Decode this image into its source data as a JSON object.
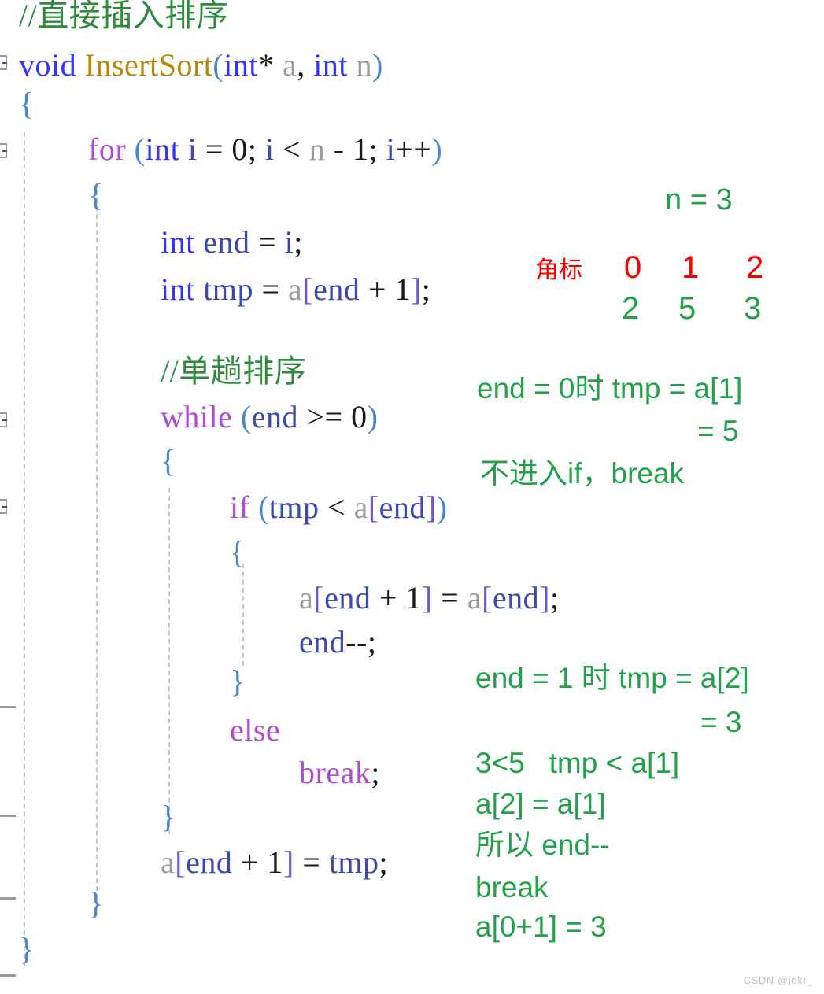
{
  "editor": {
    "language": "cpp",
    "colors": {
      "comment": "#2e8b3d",
      "keyword": "#b14ad6",
      "type": "#3333ff",
      "function": "#b8860b",
      "variable": "#3b49b0",
      "identifier": "#9b9b9b",
      "brace": "#4a86c8",
      "annotation_green": "#22a24b",
      "annotation_red": "#ff0000",
      "guide": "#c7c7c7",
      "background": "#ffffff"
    },
    "code_lines": [
      {
        "id": "comment-header",
        "indent": 1,
        "tokens": [
          {
            "cls": "t-com",
            "text": "//直接插入排序"
          }
        ]
      },
      {
        "id": "fn-signature",
        "indent": 0,
        "tokens": [
          {
            "cls": "t-type",
            "text": "void"
          },
          {
            "cls": "t-pun",
            "text": " "
          },
          {
            "cls": "t-fn",
            "text": "InsertSort"
          },
          {
            "cls": "t-brace",
            "text": "("
          },
          {
            "cls": "t-type",
            "text": "int"
          },
          {
            "cls": "t-pun",
            "text": "* "
          },
          {
            "cls": "t-gray",
            "text": "a"
          },
          {
            "cls": "t-pun",
            "text": ", "
          },
          {
            "cls": "t-type",
            "text": "int"
          },
          {
            "cls": "t-pun",
            "text": " "
          },
          {
            "cls": "t-gray",
            "text": "n"
          },
          {
            "cls": "t-brace",
            "text": ")"
          }
        ]
      },
      {
        "id": "fn-open-brace",
        "indent": 0,
        "tokens": [
          {
            "cls": "t-brace",
            "text": "{"
          }
        ]
      },
      {
        "id": "for-loop",
        "indent": 1,
        "tokens": [
          {
            "cls": "t-key",
            "text": "for"
          },
          {
            "cls": "t-pun",
            "text": " "
          },
          {
            "cls": "t-brace",
            "text": "("
          },
          {
            "cls": "t-type",
            "text": "int"
          },
          {
            "cls": "t-pun",
            "text": " "
          },
          {
            "cls": "t-var",
            "text": "i"
          },
          {
            "cls": "t-pun",
            "text": " = "
          },
          {
            "cls": "t-num",
            "text": "0"
          },
          {
            "cls": "t-pun",
            "text": "; "
          },
          {
            "cls": "t-var",
            "text": "i"
          },
          {
            "cls": "t-pun",
            "text": " < "
          },
          {
            "cls": "t-gray",
            "text": "n"
          },
          {
            "cls": "t-pun",
            "text": " - "
          },
          {
            "cls": "t-num",
            "text": "1"
          },
          {
            "cls": "t-pun",
            "text": "; "
          },
          {
            "cls": "t-var",
            "text": "i"
          },
          {
            "cls": "t-pun",
            "text": "++"
          },
          {
            "cls": "t-brace",
            "text": ")"
          }
        ]
      },
      {
        "id": "for-open-brace",
        "indent": 1,
        "tokens": [
          {
            "cls": "t-brace",
            "text": "{"
          }
        ]
      },
      {
        "id": "decl-end",
        "indent": 2,
        "tokens": [
          {
            "cls": "t-type",
            "text": "int"
          },
          {
            "cls": "t-pun",
            "text": " "
          },
          {
            "cls": "t-var",
            "text": "end"
          },
          {
            "cls": "t-pun",
            "text": " = "
          },
          {
            "cls": "t-var",
            "text": "i"
          },
          {
            "cls": "t-pun",
            "text": ";"
          }
        ]
      },
      {
        "id": "decl-tmp",
        "indent": 2,
        "tokens": [
          {
            "cls": "t-type",
            "text": "int"
          },
          {
            "cls": "t-pun",
            "text": " "
          },
          {
            "cls": "t-var",
            "text": "tmp"
          },
          {
            "cls": "t-pun",
            "text": " = "
          },
          {
            "cls": "t-gray",
            "text": "a"
          },
          {
            "cls": "t-brk",
            "text": "["
          },
          {
            "cls": "t-var",
            "text": "end"
          },
          {
            "cls": "t-pun",
            "text": " + "
          },
          {
            "cls": "t-num",
            "text": "1"
          },
          {
            "cls": "t-brk",
            "text": "]"
          },
          {
            "cls": "t-pun",
            "text": ";"
          }
        ]
      },
      {
        "id": "comment-single-pass",
        "indent": 2,
        "tokens": [
          {
            "cls": "t-com",
            "text": "//单趟排序"
          }
        ]
      },
      {
        "id": "while-loop",
        "indent": 2,
        "tokens": [
          {
            "cls": "t-key",
            "text": "while"
          },
          {
            "cls": "t-pun",
            "text": " "
          },
          {
            "cls": "t-brace",
            "text": "("
          },
          {
            "cls": "t-var",
            "text": "end"
          },
          {
            "cls": "t-pun",
            "text": " >= "
          },
          {
            "cls": "t-num",
            "text": "0"
          },
          {
            "cls": "t-brace",
            "text": ")"
          }
        ]
      },
      {
        "id": "while-open-brace",
        "indent": 2,
        "tokens": [
          {
            "cls": "t-brace",
            "text": "{"
          }
        ]
      },
      {
        "id": "if-condition",
        "indent": 3,
        "tokens": [
          {
            "cls": "t-key",
            "text": "if"
          },
          {
            "cls": "t-pun",
            "text": " "
          },
          {
            "cls": "t-brace",
            "text": "("
          },
          {
            "cls": "t-var",
            "text": "tmp"
          },
          {
            "cls": "t-pun",
            "text": " < "
          },
          {
            "cls": "t-gray",
            "text": "a"
          },
          {
            "cls": "t-brk",
            "text": "["
          },
          {
            "cls": "t-var",
            "text": "end"
          },
          {
            "cls": "t-brk",
            "text": "]"
          },
          {
            "cls": "t-brace",
            "text": ")"
          }
        ]
      },
      {
        "id": "if-open-brace",
        "indent": 3,
        "tokens": [
          {
            "cls": "t-brace",
            "text": "{"
          }
        ]
      },
      {
        "id": "shift-assign",
        "indent": 4,
        "tokens": [
          {
            "cls": "t-gray",
            "text": "a"
          },
          {
            "cls": "t-brk",
            "text": "["
          },
          {
            "cls": "t-var",
            "text": "end"
          },
          {
            "cls": "t-pun",
            "text": " + "
          },
          {
            "cls": "t-num",
            "text": "1"
          },
          {
            "cls": "t-brk",
            "text": "]"
          },
          {
            "cls": "t-pun",
            "text": " = "
          },
          {
            "cls": "t-gray",
            "text": "a"
          },
          {
            "cls": "t-brk",
            "text": "["
          },
          {
            "cls": "t-var",
            "text": "end"
          },
          {
            "cls": "t-brk",
            "text": "]"
          },
          {
            "cls": "t-pun",
            "text": ";"
          }
        ]
      },
      {
        "id": "end-decrement",
        "indent": 4,
        "tokens": [
          {
            "cls": "t-var",
            "text": "end"
          },
          {
            "cls": "t-pun",
            "text": "--;"
          }
        ]
      },
      {
        "id": "if-close-brace",
        "indent": 3,
        "tokens": [
          {
            "cls": "t-brace",
            "text": "}"
          }
        ]
      },
      {
        "id": "else-keyword",
        "indent": 3,
        "tokens": [
          {
            "cls": "t-key",
            "text": "else"
          }
        ]
      },
      {
        "id": "break-statement",
        "indent": 4,
        "tokens": [
          {
            "cls": "t-key",
            "text": "break"
          },
          {
            "cls": "t-pun",
            "text": ";"
          }
        ]
      },
      {
        "id": "while-close-brace",
        "indent": 2,
        "tokens": [
          {
            "cls": "t-brace",
            "text": "}"
          }
        ]
      },
      {
        "id": "final-assign",
        "indent": 2,
        "tokens": [
          {
            "cls": "t-gray",
            "text": "a"
          },
          {
            "cls": "t-brk",
            "text": "["
          },
          {
            "cls": "t-var",
            "text": "end"
          },
          {
            "cls": "t-pun",
            "text": " + "
          },
          {
            "cls": "t-num",
            "text": "1"
          },
          {
            "cls": "t-brk",
            "text": "]"
          },
          {
            "cls": "t-pun",
            "text": " = "
          },
          {
            "cls": "t-var",
            "text": "tmp"
          },
          {
            "cls": "t-pun",
            "text": ";"
          }
        ]
      },
      {
        "id": "for-close-brace",
        "indent": 1,
        "tokens": [
          {
            "cls": "t-brace",
            "text": "}"
          }
        ]
      },
      {
        "id": "fn-close-brace",
        "indent": 0,
        "tokens": [
          {
            "cls": "t-brace",
            "text": "}"
          }
        ]
      }
    ]
  },
  "annotations": {
    "n_value": "n = 3",
    "index_label": "角标",
    "indices": [
      "0",
      "1",
      "2"
    ],
    "values": [
      "2",
      "5",
      "3"
    ],
    "pass_one": {
      "line1": "end = 0时 tmp = a[1]",
      "line2": "= 5",
      "line3": "不进入if，break"
    },
    "pass_two": {
      "line1": "end = 1 时 tmp = a[2]",
      "line2": "= 3",
      "line3": "3<5   tmp < a[1]",
      "line4": "a[2] = a[1]",
      "line5": "所以 end--",
      "line6": "break",
      "line7": "a[0+1] = 3"
    }
  },
  "watermark": "CSDN @jokr_"
}
